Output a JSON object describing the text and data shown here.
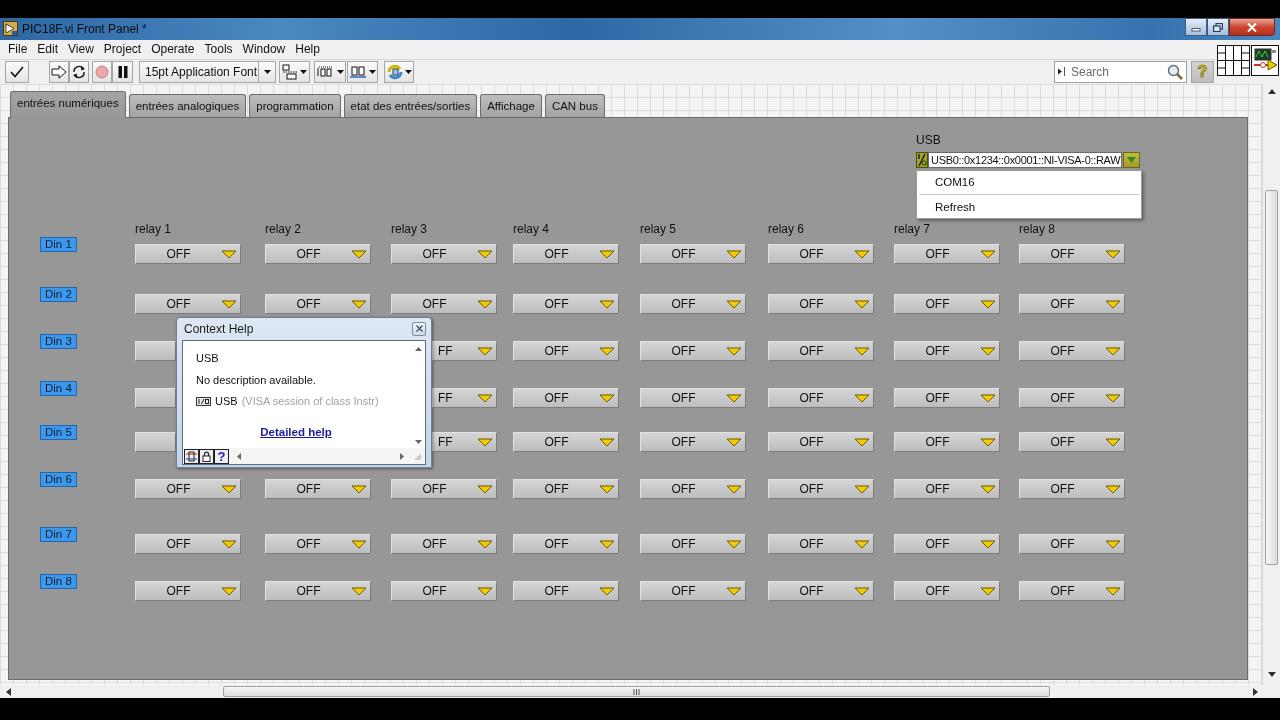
{
  "window": {
    "title": "PIC18F.vi Front Panel *"
  },
  "menu": [
    "File",
    "Edit",
    "View",
    "Project",
    "Operate",
    "Tools",
    "Window",
    "Help"
  ],
  "toolbar": {
    "font": "15pt Application Font",
    "search": {
      "placeholder": "Search"
    },
    "help_button": "?"
  },
  "tabs": [
    {
      "label": "entrées numériques",
      "selected": true
    },
    {
      "label": "entrées analogiques",
      "selected": false
    },
    {
      "label": "programmation",
      "selected": false
    },
    {
      "label": "etat des entrées/sorties",
      "selected": false
    },
    {
      "label": "Affichage",
      "selected": false
    },
    {
      "label": "CAN bus",
      "selected": false
    }
  ],
  "usb": {
    "label": "USB",
    "value": "USB0::0x1234::0x0001::NI-VISA-0::RAW",
    "menu": [
      {
        "kind": "option",
        "label": "COM16",
        "selected": false
      },
      {
        "kind": "separator"
      },
      {
        "kind": "option",
        "label": "Refresh",
        "selected": false
      }
    ]
  },
  "relays": [
    "relay 1",
    "relay 2",
    "relay 3",
    "relay 4",
    "relay 5",
    "relay 6",
    "relay 7",
    "relay 8"
  ],
  "rows": [
    {
      "label": "Din 1",
      "switches": [
        {
          "kind": "full",
          "text": "OFF"
        },
        {
          "kind": "full",
          "text": "OFF"
        },
        {
          "kind": "full",
          "text": "OFF"
        },
        {
          "kind": "full",
          "text": "OFF"
        },
        {
          "kind": "full",
          "text": "OFF"
        },
        {
          "kind": "full",
          "text": "OFF"
        },
        {
          "kind": "full",
          "text": "OFF"
        },
        {
          "kind": "full",
          "text": "OFF"
        }
      ]
    },
    {
      "label": "Din 2",
      "switches": [
        {
          "kind": "full",
          "text": "OFF"
        },
        {
          "kind": "full",
          "text": "OFF"
        },
        {
          "kind": "full",
          "text": "OFF"
        },
        {
          "kind": "full",
          "text": "OFF"
        },
        {
          "kind": "full",
          "text": "OFF"
        },
        {
          "kind": "full",
          "text": "OFF"
        },
        {
          "kind": "full",
          "text": "OFF"
        },
        {
          "kind": "full",
          "text": "OFF"
        }
      ]
    },
    {
      "label": "Din 3",
      "switches": [
        {
          "kind": "covered"
        },
        {
          "kind": "hidden"
        },
        {
          "kind": "clipped",
          "text": "FF"
        },
        {
          "kind": "full",
          "text": "OFF"
        },
        {
          "kind": "full",
          "text": "OFF"
        },
        {
          "kind": "full",
          "text": "OFF"
        },
        {
          "kind": "full",
          "text": "OFF"
        },
        {
          "kind": "full",
          "text": "OFF"
        }
      ]
    },
    {
      "label": "Din 4",
      "switches": [
        {
          "kind": "covered"
        },
        {
          "kind": "hidden"
        },
        {
          "kind": "clipped",
          "text": "FF"
        },
        {
          "kind": "full",
          "text": "OFF"
        },
        {
          "kind": "full",
          "text": "OFF"
        },
        {
          "kind": "full",
          "text": "OFF"
        },
        {
          "kind": "full",
          "text": "OFF"
        },
        {
          "kind": "full",
          "text": "OFF"
        }
      ]
    },
    {
      "label": "Din 5",
      "switches": [
        {
          "kind": "covered"
        },
        {
          "kind": "hidden"
        },
        {
          "kind": "clipped",
          "text": "FF"
        },
        {
          "kind": "full",
          "text": "OFF"
        },
        {
          "kind": "full",
          "text": "OFF"
        },
        {
          "kind": "full",
          "text": "OFF"
        },
        {
          "kind": "full",
          "text": "OFF"
        },
        {
          "kind": "full",
          "text": "OFF"
        }
      ]
    },
    {
      "label": "Din 6",
      "switches": [
        {
          "kind": "full",
          "text": "OFF"
        },
        {
          "kind": "full",
          "text": "OFF"
        },
        {
          "kind": "full",
          "text": "OFF"
        },
        {
          "kind": "full",
          "text": "OFF"
        },
        {
          "kind": "full",
          "text": "OFF"
        },
        {
          "kind": "full",
          "text": "OFF"
        },
        {
          "kind": "full",
          "text": "OFF"
        },
        {
          "kind": "full",
          "text": "OFF"
        }
      ]
    },
    {
      "label": "Din 7",
      "switches": [
        {
          "kind": "full",
          "text": "OFF"
        },
        {
          "kind": "full",
          "text": "OFF"
        },
        {
          "kind": "full",
          "text": "OFF"
        },
        {
          "kind": "full",
          "text": "OFF"
        },
        {
          "kind": "full",
          "text": "OFF"
        },
        {
          "kind": "full",
          "text": "OFF"
        },
        {
          "kind": "full",
          "text": "OFF"
        },
        {
          "kind": "full",
          "text": "OFF"
        }
      ]
    },
    {
      "label": "Din 8",
      "switches": [
        {
          "kind": "full",
          "text": "OFF"
        },
        {
          "kind": "full",
          "text": "OFF"
        },
        {
          "kind": "full",
          "text": "OFF"
        },
        {
          "kind": "full",
          "text": "OFF"
        },
        {
          "kind": "full",
          "text": "OFF"
        },
        {
          "kind": "full",
          "text": "OFF"
        },
        {
          "kind": "full",
          "text": "OFF"
        },
        {
          "kind": "full",
          "text": "OFF"
        }
      ]
    }
  ],
  "context_help": {
    "title": "Context Help",
    "heading": "USB",
    "description": "No description available.",
    "terminal": "USB",
    "terminal_type": "(VISA session of class Instr)",
    "link": "Detailed help",
    "help_button": "?"
  }
}
